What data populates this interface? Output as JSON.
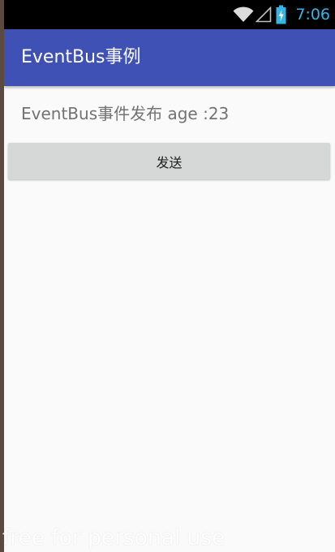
{
  "status_bar": {
    "time": "7:06",
    "icons": [
      "wifi-icon",
      "signal-icon",
      "battery-charging-icon"
    ],
    "time_color": "#33b5e5"
  },
  "app_bar": {
    "title": "EventBus事例",
    "color": "#3f51b5"
  },
  "main": {
    "event_text": "EventBus事件发布 age :23",
    "send_button_label": "发送"
  },
  "watermark": "free for personal use"
}
